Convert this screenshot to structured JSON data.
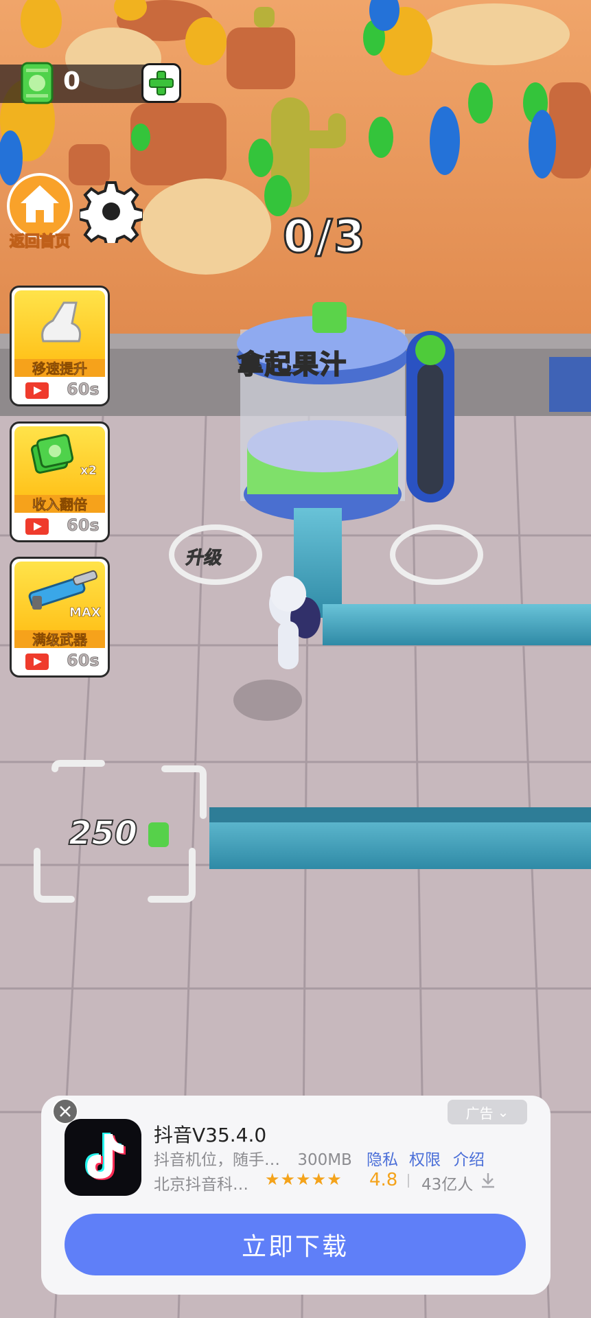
{
  "hud": {
    "cash_value": "0",
    "progress": "0/3",
    "home_label": "返回首页"
  },
  "scene_labels": {
    "task": "拿起果汁",
    "upgrade": "升级",
    "price": "250"
  },
  "boosters": [
    {
      "title": "移速提升",
      "time": "60s",
      "badge": ""
    },
    {
      "title": "收入翻倍",
      "time": "60s",
      "badge": "x2"
    },
    {
      "title": "满级武器",
      "time": "60s",
      "badge": "MAX"
    }
  ],
  "ad": {
    "tag": "广告",
    "app_name": "抖音V35.4.0",
    "desc": "抖音机位，随手…",
    "size": "300MB",
    "links": [
      "隐私",
      "权限",
      "介绍"
    ],
    "developer": "北京抖音科…",
    "stars": "★★★★★",
    "rating": "4.8",
    "installs": "43亿人",
    "cta": "立即下载"
  },
  "colors": {
    "accent": "#5f7ff8",
    "star": "#f4a31b",
    "floor": "#c7b8bd",
    "desert": "#e9955a"
  },
  "icons": [
    "cash-icon",
    "plus-icon",
    "home-icon",
    "gear-icon",
    "video-icon",
    "close-icon",
    "tiktok-logo",
    "download-icon"
  ]
}
